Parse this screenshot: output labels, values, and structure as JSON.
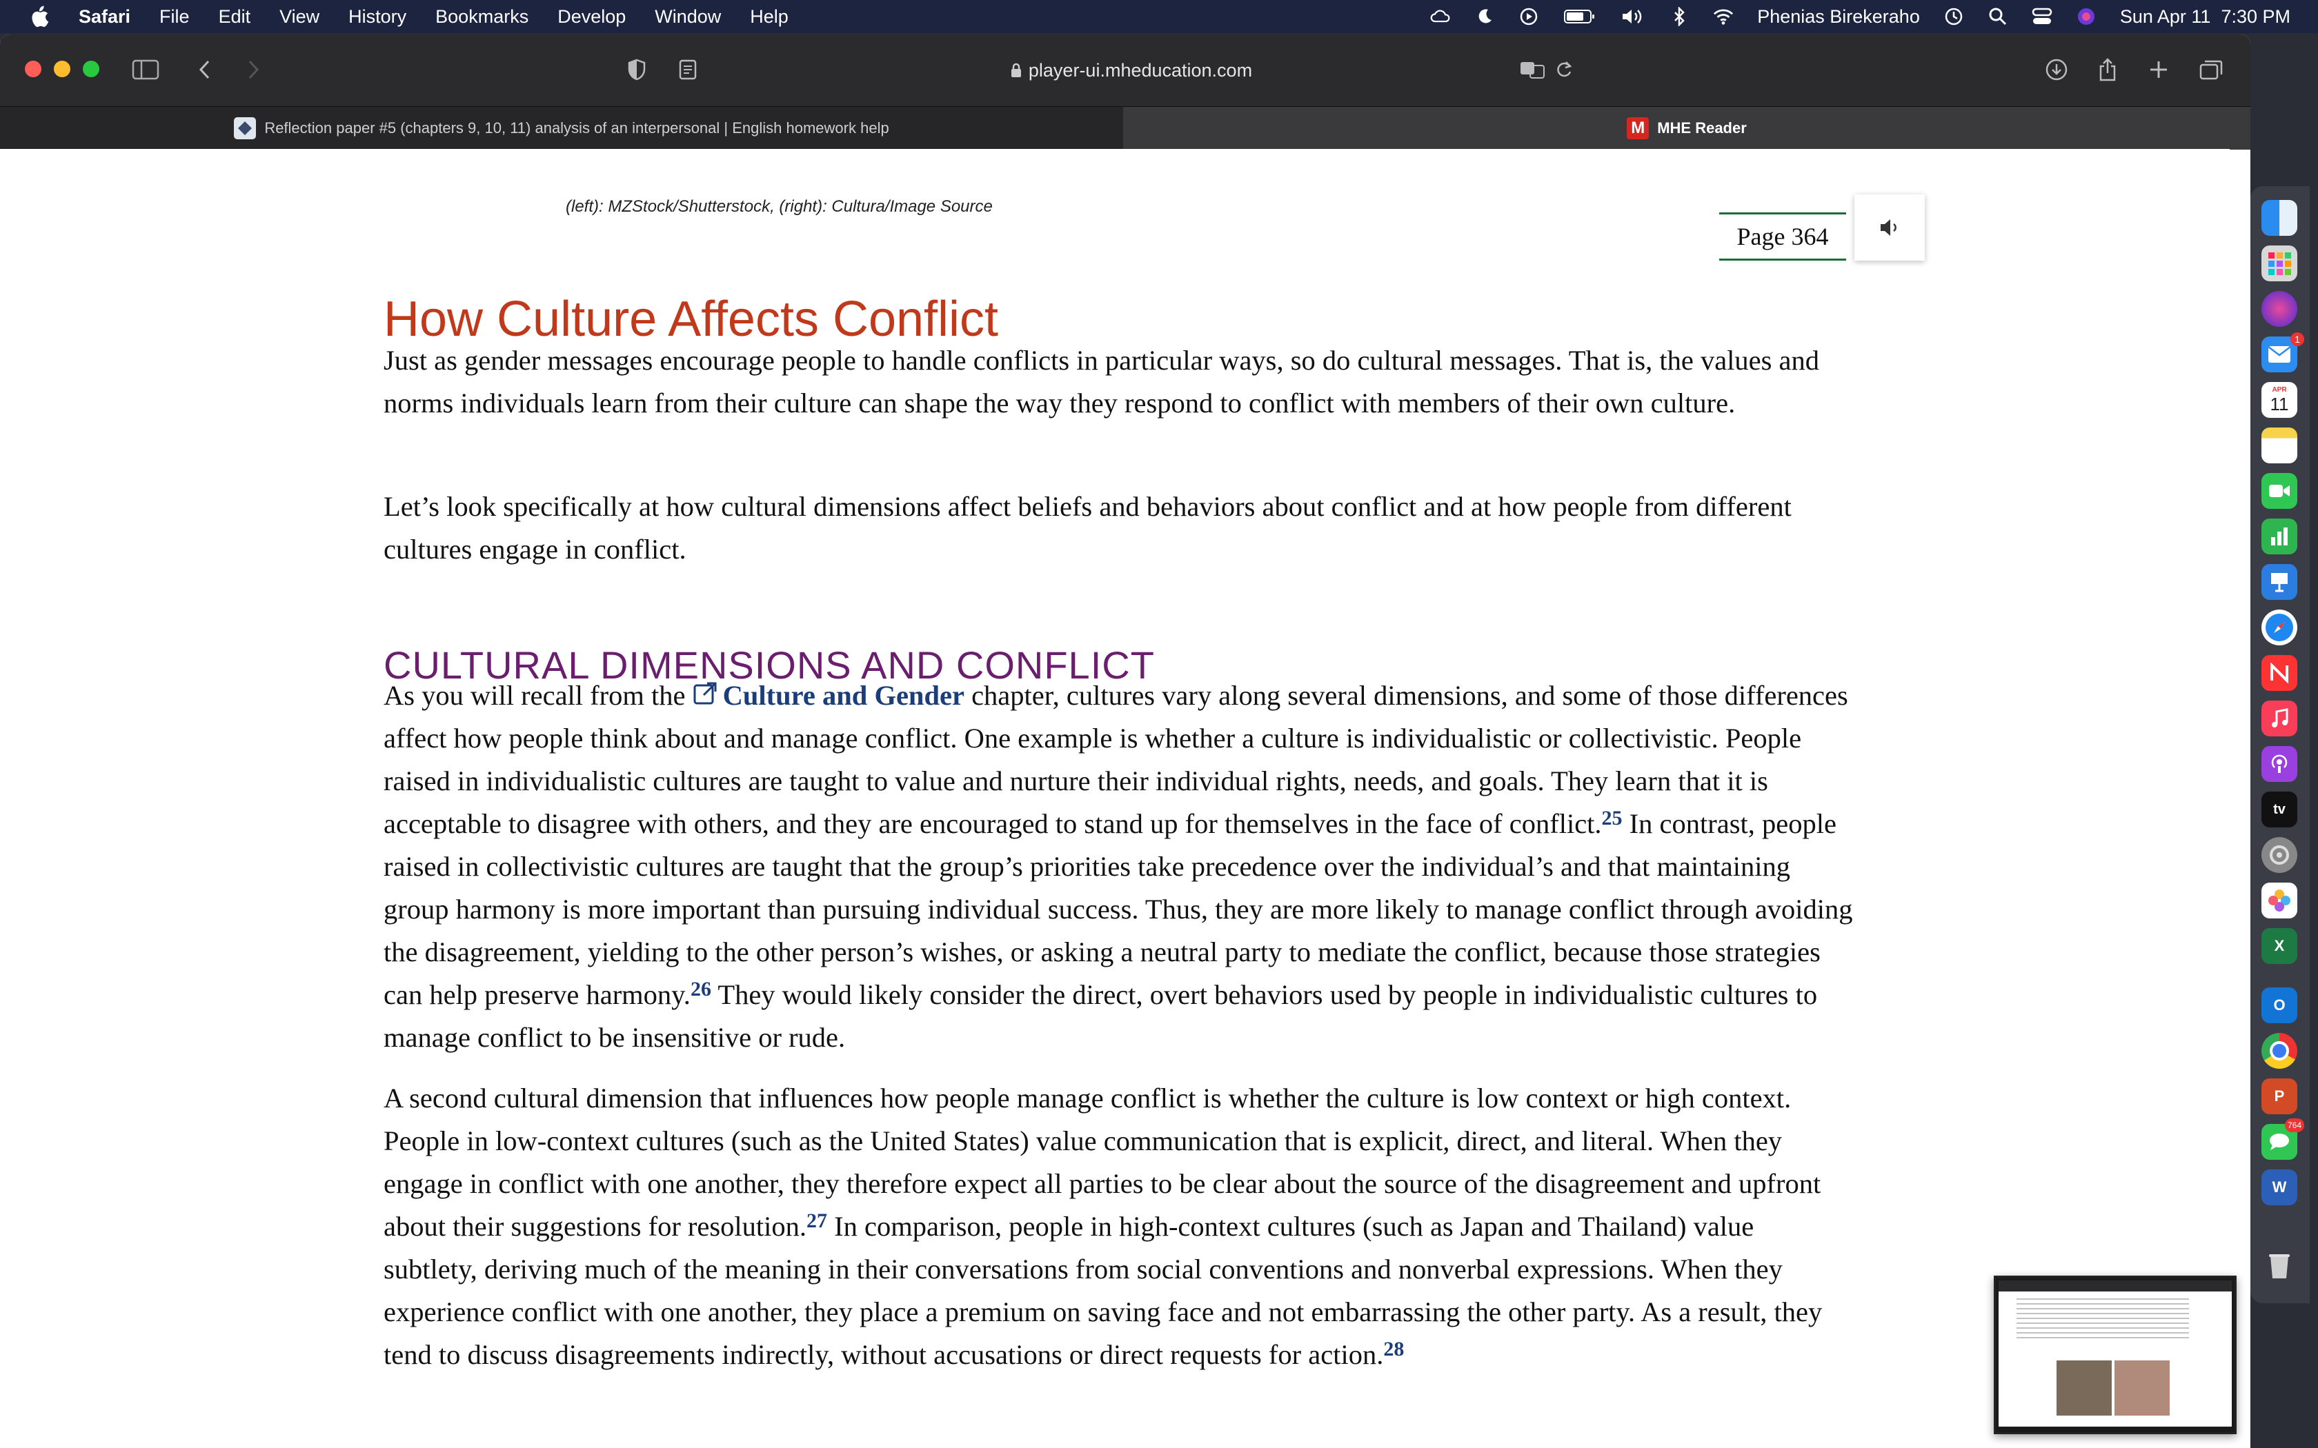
{
  "menubar": {
    "app_name": "Safari",
    "items": [
      "File",
      "Edit",
      "View",
      "History",
      "Bookmarks",
      "Develop",
      "Window",
      "Help"
    ],
    "user_name": "Phenias Birekeraho",
    "datetime": "Sun Apr 11  7:30 PM"
  },
  "browser": {
    "url": "player-ui.mheducation.com",
    "tabs": [
      {
        "label": "Reflection paper #5 (chapters 9, 10, 11) analysis of an interpersonal | English homework help"
      },
      {
        "label": "MHE Reader",
        "favicon_letter": "M"
      }
    ]
  },
  "page": {
    "caption": "(left): MZStock/Shutterstock, (right): Cultura/Image Source",
    "page_label": "Page 364",
    "heading": "How Culture Affects Conflict",
    "para1": "Just as gender messages encourage people to handle conflicts in particular ways, so do cultural messages. That is, the values and norms individuals learn from their culture can shape the way they respond to conflict with members of their own culture.",
    "para2": "Let’s look specifically at how cultural dimensions affect beliefs and behaviors about conflict and at how people from different cultures engage in conflict.",
    "subheading": "CULTURAL DIMENSIONS AND CONFLICT",
    "para3": {
      "a": "As you will recall from the ",
      "link": "Culture and Gender",
      "b": " chapter, cultures vary along several dimensions, and some of those differences affect how people think about and manage conflict. One example is whether a culture is individualistic or collectivistic. People raised in individualistic cultures are taught to value and nurture their individual rights, needs, and goals. They learn that it is acceptable to disagree with others, and they are encouraged to stand up for themselves in the face of conflict.",
      "ref1": "25",
      "c": " In contrast, people raised in collectivistic cultures are taught that the group’s priorities take precedence over the individual’s and that maintaining group harmony is more important than pursuing individual success. Thus, they are more likely to manage conflict through avoiding the disagreement, yielding to the other person’s wishes, or asking a neutral party to mediate the conflict, because those strategies can help preserve harmony.",
      "ref2": "26",
      "d": " They would likely consider the direct, overt behaviors used by people in individualistic cultures to manage conflict to be insensitive or rude."
    },
    "para4": {
      "a": "A second cultural dimension that influences how people manage conflict is whether the culture is low context or high context. People in low-context cultures (such as the United States) value communication that is explicit, direct, and literal. When they engage in conflict with one another, they therefore expect all parties to be clear about the source of the disagreement and upfront about their suggestions for resolution.",
      "ref1": "27",
      "b": " In comparison, people in high-context cultures (such as Japan and Thailand) value subtlety, deriving much of the meaning in their conversations from social conventions and nonverbal expressions. When they experience conflict with one another, they place a premium on saving face and not embarrassing the other party. As a result, they tend to discuss disagreements indirectly, without accusations or direct requests for action.",
      "ref2": "28"
    }
  },
  "dock": {
    "calendar_month": "APR",
    "calendar_day": "11",
    "mail_badge": "1",
    "messages_badge": "764",
    "icons": [
      "finder-icon",
      "launchpad-icon",
      "siri-icon",
      "mail-icon",
      "calendar-icon",
      "notes-icon",
      "facetime-icon",
      "numbers-icon",
      "keynote-icon",
      "safari-icon",
      "news-icon",
      "music-icon",
      "podcasts-icon",
      "tv-icon",
      "system-preferences-icon",
      "photos-icon",
      "excel-icon",
      "outlook-icon",
      "chrome-icon",
      "powerpoint-icon",
      "messages-icon",
      "word-icon",
      "trash-icon"
    ]
  },
  "colors": {
    "heading": "#c0391b",
    "subheading": "#6b1d6e",
    "link": "#1b3d7a",
    "menubar": "#1d2440"
  }
}
